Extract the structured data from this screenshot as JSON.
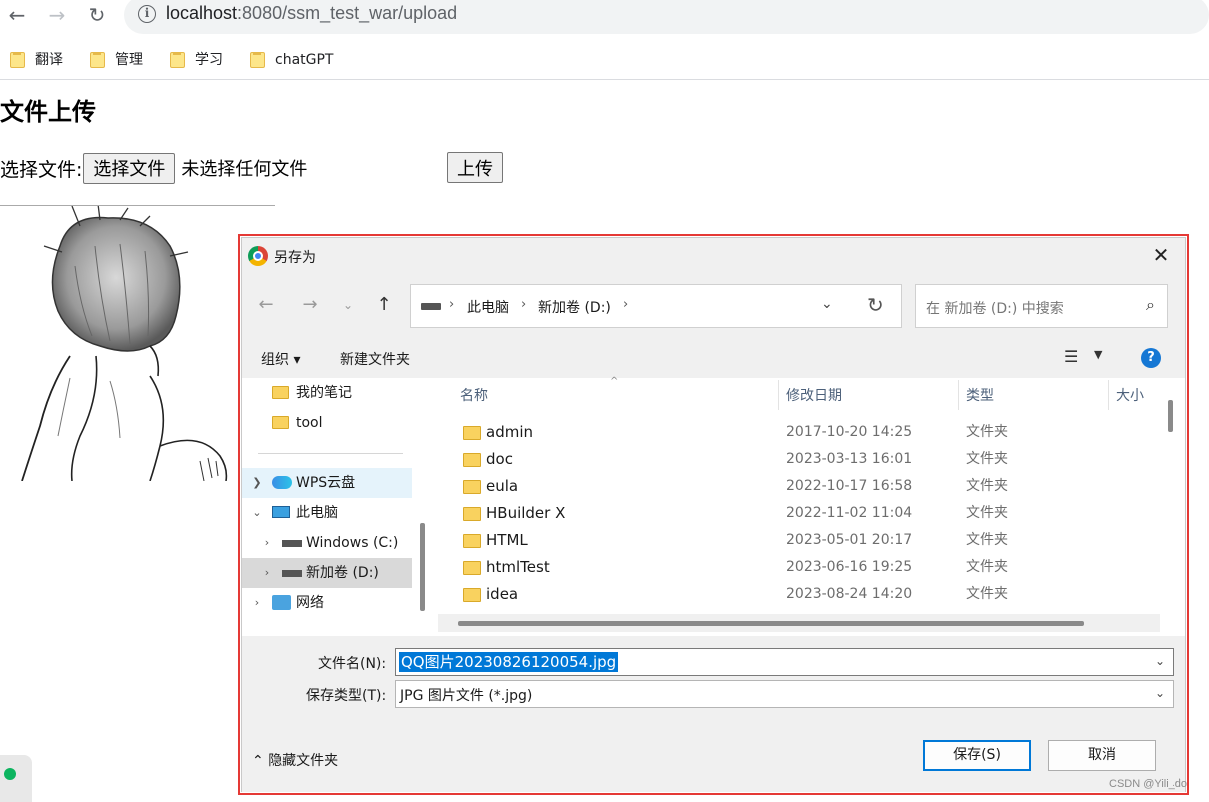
{
  "browser": {
    "url_host": "localhost",
    "url_rest": ":8080/ssm_test_war/upload",
    "bookmarks": [
      "翻译",
      "管理",
      "学习",
      "chatGPT"
    ]
  },
  "page": {
    "title": "文件上传",
    "choose_label": "选择文件:",
    "file_button": "选择文件",
    "file_status": "未选择任何文件",
    "upload_button": "上传"
  },
  "dialog": {
    "title": "另存为",
    "breadcrumb": [
      "此电脑",
      "新加卷 (D:)"
    ],
    "search_placeholder": "在 新加卷 (D:) 中搜索",
    "organize": "组织 ▾",
    "new_folder": "新建文件夹",
    "help": "?",
    "tree": [
      {
        "label": "我的笔记"
      },
      {
        "label": "tool"
      },
      {
        "label": "WPS云盘"
      },
      {
        "label": "此电脑"
      },
      {
        "label": "Windows (C:)"
      },
      {
        "label": "新加卷 (D:)"
      },
      {
        "label": "网络"
      }
    ],
    "columns": [
      "名称",
      "修改日期",
      "类型",
      "大小"
    ],
    "files": [
      {
        "name": "admin",
        "date": "2017-10-20 14:25",
        "type": "文件夹"
      },
      {
        "name": "doc",
        "date": "2023-03-13 16:01",
        "type": "文件夹"
      },
      {
        "name": "eula",
        "date": "2022-10-17 16:58",
        "type": "文件夹"
      },
      {
        "name": "HBuilder X",
        "date": "2022-11-02 11:04",
        "type": "文件夹"
      },
      {
        "name": "HTML",
        "date": "2023-05-01 20:17",
        "type": "文件夹"
      },
      {
        "name": "htmlTest",
        "date": "2023-06-16 19:25",
        "type": "文件夹"
      },
      {
        "name": "idea",
        "date": "2023-08-24 14:20",
        "type": "文件夹"
      }
    ],
    "filename_label": "文件名(N):",
    "filename_value": "QQ图片20230826120054.jpg",
    "filetype_label": "保存类型(T):",
    "filetype_value": "JPG 图片文件 (*.jpg)",
    "hide_folders": "隐藏文件夹",
    "save_button": "保存(S)",
    "cancel_button": "取消"
  },
  "watermark": "CSDN @Yili_do",
  "colors": {
    "highlight": "#e53935",
    "selection": "#0078d7",
    "primary_border": "#0078d7"
  }
}
